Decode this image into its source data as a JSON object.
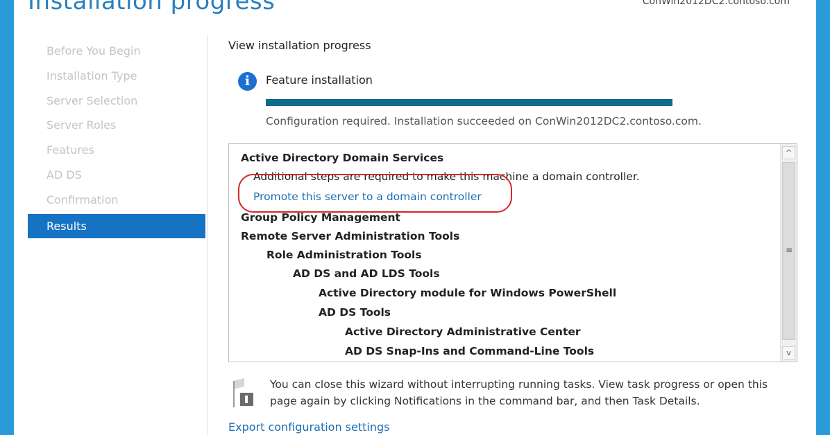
{
  "window": {
    "title": "Installation progress",
    "server_name": "ConWin2012DC2.contoso.com"
  },
  "nav": {
    "items": [
      {
        "label": "Before You Begin"
      },
      {
        "label": "Installation Type"
      },
      {
        "label": "Server Selection"
      },
      {
        "label": "Server Roles"
      },
      {
        "label": "Features"
      },
      {
        "label": "AD DS"
      },
      {
        "label": "Confirmation"
      },
      {
        "label": "Results"
      }
    ],
    "active": "Results"
  },
  "main": {
    "section_label": "View installation progress",
    "feature_title": "Feature installation",
    "info_glyph": "i",
    "progress_fraction": 1.0,
    "status": "Configuration required. Installation succeeded on ConWin2012DC2.contoso.com."
  },
  "results": {
    "rows": [
      {
        "text": "Active Directory Domain Services"
      },
      {
        "text": "Additional steps are required to make this machine a domain controller."
      },
      {
        "text": "Promote this server to a domain controller"
      },
      {
        "text": "Group Policy Management"
      },
      {
        "text": "Remote Server Administration Tools"
      },
      {
        "text": "Role Administration Tools"
      },
      {
        "text": "AD DS and AD LDS Tools"
      },
      {
        "text": "Active Directory module for Windows PowerShell"
      },
      {
        "text": "AD DS Tools"
      },
      {
        "text": "Active Directory Administrative Center"
      },
      {
        "text": "AD DS Snap-Ins and Command-Line Tools"
      }
    ],
    "scroll_up_glyph": "^",
    "scroll_down_glyph": "v",
    "grip_glyph": "≡"
  },
  "note": {
    "text": "You can close this wizard without interrupting running tasks. View task progress or open this page again by clicking Notifications in the command bar, and then Task Details."
  },
  "export_link": "Export configuration settings",
  "colors": {
    "accent": "#1673c4",
    "progress": "#0f6b8a",
    "link": "#1a6eb3",
    "highlight": "#d9252a",
    "frame": "#2b9bd8"
  },
  "icons": {
    "info": "info-icon",
    "flag": "flag-icon"
  }
}
